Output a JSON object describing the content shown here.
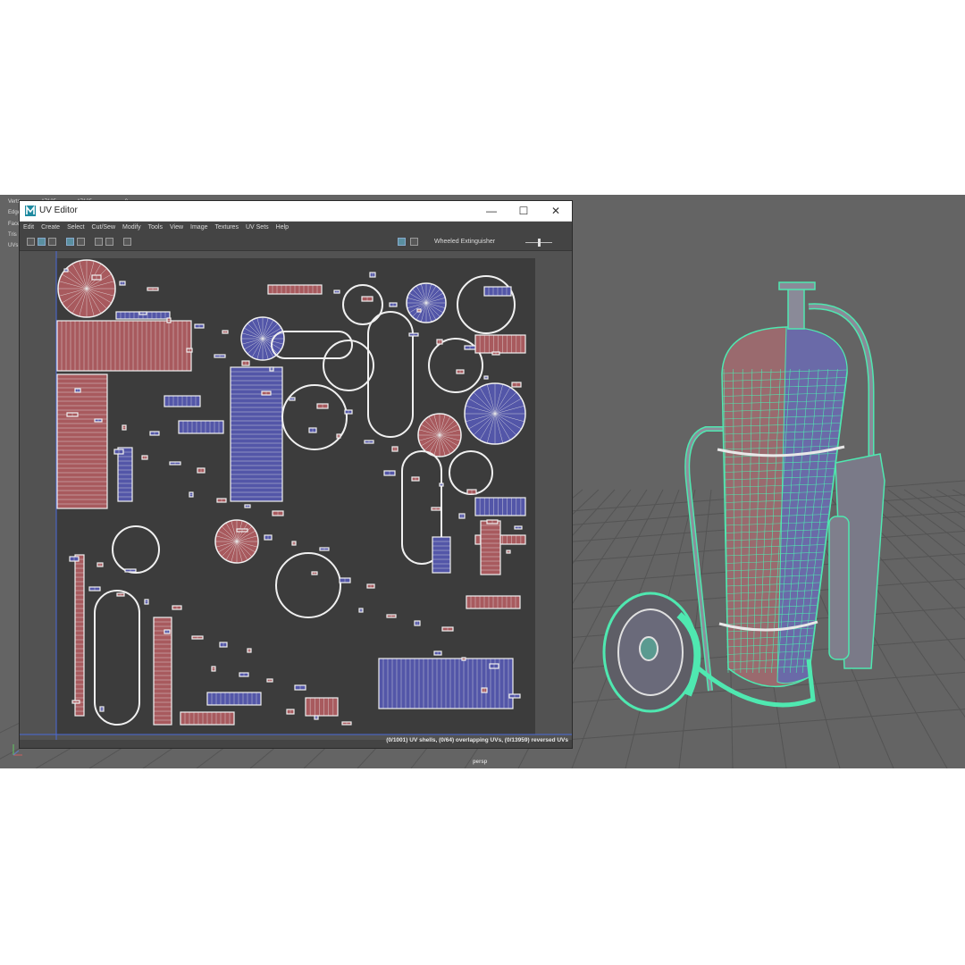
{
  "hud": {
    "rows": [
      {
        "label": "Verts",
        "a": "17125",
        "b": "17125",
        "c": "0"
      },
      {
        "label": "Edges",
        "a": "",
        "b": "",
        "c": ""
      },
      {
        "label": "Faces",
        "a": "",
        "b": "",
        "c": ""
      },
      {
        "label": "Tris",
        "a": "",
        "b": "",
        "c": ""
      },
      {
        "label": "UVs",
        "a": "",
        "b": "",
        "c": ""
      }
    ]
  },
  "window": {
    "title": "UV Editor",
    "minimize": "—",
    "maximize": "☐",
    "close": "✕"
  },
  "menu": [
    "Edit",
    "Create",
    "Select",
    "Cut/Sew",
    "Modify",
    "Tools",
    "View",
    "Image",
    "Textures",
    "UV Sets",
    "Help"
  ],
  "toolbar": {
    "uv_set_name": "Wheeled Extinguisher"
  },
  "status": {
    "text": "(0/1001) UV shells, (0/64) overlapping UVs, (0/13959) reversed UVs"
  },
  "viewport": {
    "camera_label": "persp"
  },
  "colors": {
    "viewport_bg": "#646464",
    "uv_bg": "#525252",
    "shell_red": "#a85a5e",
    "shell_blue": "#5356a8",
    "wire_green": "#4fe8b0",
    "body_red": "#9a6a6e",
    "body_blue": "#6a6aa8"
  }
}
